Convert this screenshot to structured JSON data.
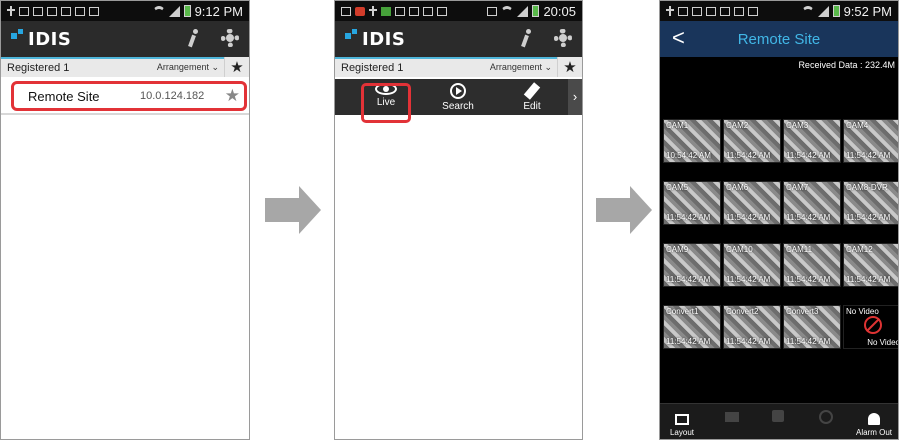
{
  "screen1": {
    "status_time": "9:12 PM",
    "logo": "IDIS",
    "group_label": "Registered 1",
    "arrangement_label": "Arrangement",
    "site": {
      "name": "Remote Site",
      "ip": "10.0.124.182"
    },
    "icons": [
      "usb-icon",
      "image-icon",
      "mail-icon",
      "mail-icon",
      "message-icon",
      "message-icon",
      "bag-icon",
      "wifi-icon",
      "signal-icon",
      "battery-icon",
      "runner-icon",
      "gear-icon",
      "star-icon"
    ]
  },
  "screen2": {
    "status_time": "20:05",
    "logo": "IDIS",
    "group_label": "Registered 1",
    "arrangement_label": "Arrangement",
    "actions": [
      {
        "label": "Live",
        "icon": "eye-icon"
      },
      {
        "label": "Search",
        "icon": "play-icon"
      },
      {
        "label": "Edit",
        "icon": "pencil-icon"
      }
    ],
    "more_glyph": "›"
  },
  "screen3": {
    "status_time": "9:52 PM",
    "back_glyph": "<",
    "title": "Remote Site",
    "received": "Received Data : 232.4M",
    "cells": [
      {
        "cam": "CAM1",
        "time": "10:54:42 AM"
      },
      {
        "cam": "CAM2",
        "time": "11:54:42 AM"
      },
      {
        "cam": "CAM3",
        "time": "11:54:42 AM"
      },
      {
        "cam": "CAM4",
        "time": "11:54:42 AM"
      },
      {
        "cam": "CAM5",
        "time": "11:54:42 AM"
      },
      {
        "cam": "CAM6",
        "time": "11:54:42 AM"
      },
      {
        "cam": "CAM7",
        "time": "11:54:42 AM"
      },
      {
        "cam": "CAM8-DVR",
        "time": "11:54:42 AM"
      },
      {
        "cam": "CAM9",
        "time": "11:54:42 AM"
      },
      {
        "cam": "CAM10",
        "time": "11:54:42 AM"
      },
      {
        "cam": "CAM11",
        "time": "11:54:42 AM"
      },
      {
        "cam": "CAM12",
        "time": "11:54:42 AM"
      },
      {
        "cam": "Convert1",
        "time": "11:54:42 AM"
      },
      {
        "cam": "Convert2",
        "time": "11:54:42 AM"
      },
      {
        "cam": "Convert3",
        "time": "11:54:42 AM"
      },
      {
        "cam": "No Video",
        "time": "No Video"
      }
    ],
    "bottom": [
      {
        "label": "Layout",
        "icon": "layout-icon"
      },
      {
        "label": "",
        "icon": "camera-icon"
      },
      {
        "label": "",
        "icon": "speaker-icon"
      },
      {
        "label": "",
        "icon": "ptz-icon"
      },
      {
        "label": "Alarm Out",
        "icon": "bell-icon"
      }
    ]
  },
  "colors": {
    "highlight": "#e23237",
    "logo_blue": "#27a6e0",
    "live_header": "#19355b",
    "title_blue": "#41b6e6",
    "arrow": "#a7a7a7"
  }
}
